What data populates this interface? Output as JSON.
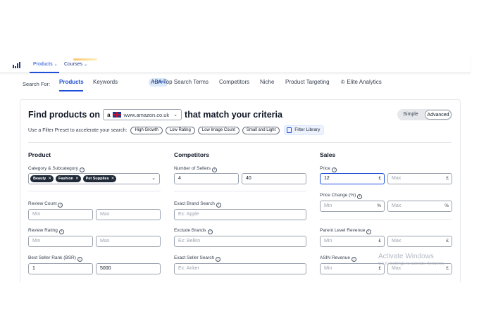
{
  "topnav": {
    "items": [
      {
        "label": "Products",
        "chevron": "chevron-down-icon"
      },
      {
        "label": "Courses",
        "chevron": "chevron-down-icon"
      }
    ]
  },
  "tabs": {
    "label": "Search For:",
    "items": [
      {
        "label": "Products",
        "active": true
      },
      {
        "label": "Keywords"
      },
      {
        "label": "ABA Top Search Terms",
        "badge": "New"
      },
      {
        "label": "Competitors"
      },
      {
        "label": "Niche"
      },
      {
        "label": "Product Targeting"
      },
      {
        "label": "Elite Analytics",
        "icon": "crown-icon"
      }
    ]
  },
  "finder": {
    "title_pre": "Find products on",
    "marketplace_logo": "a",
    "marketplace": "www.amazon.co.uk",
    "title_post": "that match your criteria",
    "modes": [
      "Simple",
      "Advanced"
    ],
    "active_mode": "Advanced",
    "preset_text": "Use a Filter Preset to accelerate your search:",
    "presets": [
      "High Growth",
      "Low Rating",
      "Low Image Count",
      "Small and Light"
    ],
    "filter_library": "Filter Library"
  },
  "product": {
    "title": "Product",
    "category_label": "Category & Subcategory",
    "categories": [
      "Beauty",
      "Fashion",
      "Pet Supplies"
    ],
    "review_count_label": "Review Count",
    "review_rating_label": "Review Rating",
    "bsr_label": "Best Seller Rank (BSR)",
    "bsr_min": "1",
    "bsr_max": "5000",
    "min_placeholder": "Min",
    "max_placeholder": "Max"
  },
  "competitors": {
    "title": "Competitors",
    "sellers_label": "Number of Sellers",
    "sellers_min": "4",
    "sellers_max": "40",
    "brand_search_label": "Exact Brand Search",
    "brand_search_placeholder": "Ex: Apple",
    "exclude_brands_label": "Exclude Brands",
    "exclude_brands_placeholder": "Ex: Belkin",
    "seller_search_label": "Exact Seller Search",
    "seller_search_placeholder": "Ex: Anker"
  },
  "sales": {
    "title": "Sales",
    "price_label": "Price",
    "price_min": "12",
    "currency": "£",
    "price_change_label": "Price Change (%)",
    "percent": "%",
    "parent_revenue_label": "Parent Level Revenue",
    "asin_revenue_label": "ASIN Revenue",
    "min_placeholder": "Min",
    "max_placeholder": "Max"
  },
  "watermark": {
    "title": "Activate Windows",
    "subtitle": "Go to Settings to activate Windows."
  }
}
